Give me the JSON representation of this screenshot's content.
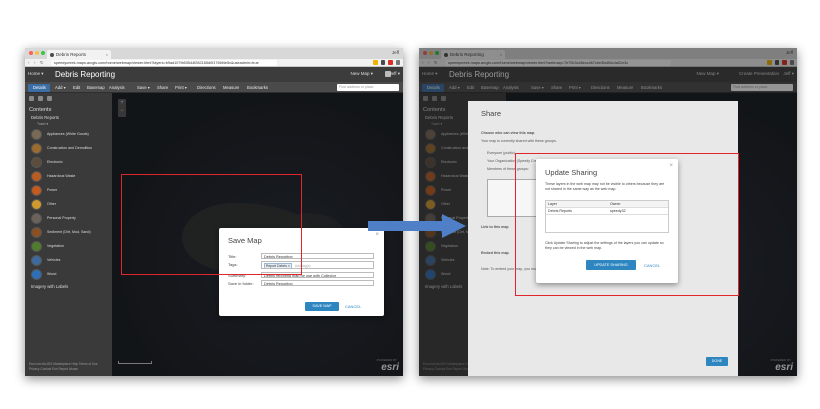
{
  "left_window": {
    "tab_title": "Debris Reports",
    "user_tag": "Jeff",
    "url": "speedycreek.maps.arcgis.com/home/webmap/viewer.html?layers=b9ad107fb53544f282165d0f1766f4e5c&useadmin=true",
    "home": "Home ▾",
    "map_title": "Debris Reporting",
    "new_map": "New Map ▾",
    "create_presentation": "",
    "user_menu": "Jeff ▾",
    "toolbar": {
      "details": "Details",
      "add": "Add ▾",
      "edit": "Edit",
      "basemap": "Basemap",
      "analysis": "Analysis",
      "save": "Save ▾",
      "share": "Share",
      "print": "Print ▾",
      "directions": "Directions",
      "measure": "Measure",
      "bookmarks": "Bookmarks",
      "search_placeholder": "Find address or place"
    },
    "contents": {
      "heading": "Contents",
      "root_layer": "Debris Reports",
      "sub_label": "Trash ▾",
      "layers": [
        {
          "label": "Appliances (White Goods)",
          "color": "#7a6a55"
        },
        {
          "label": "Construction and Demolition",
          "color": "#9c6b2d"
        },
        {
          "label": "Electronic",
          "color": "#5b4c3b"
        },
        {
          "label": "Hazardous Waste",
          "color": "#b85c22"
        },
        {
          "label": "Power",
          "color": "#c45a1d"
        },
        {
          "label": "Other",
          "color": "#d09a2c"
        },
        {
          "label": "Personal Property",
          "color": "#6b6259"
        },
        {
          "label": "Sediment (Dirt, Mud, Sand)",
          "color": "#8a4f23"
        },
        {
          "label": "Vegetation",
          "color": "#4f7d2b"
        },
        {
          "label": "Vehicles",
          "color": "#3d6a9c"
        },
        {
          "label": "Wood",
          "color": "#2d6fb8"
        }
      ],
      "imagery_label": "Imagery with Labels"
    },
    "footer": "Esri.com  ArcGIS Marketplace  Help  Terms of Use  Privacy  Contact Esri  Report Abuse",
    "dialog": {
      "title": "Save Map",
      "labels": {
        "title": "Title:",
        "tags": "Tags:",
        "summary": "Summary:",
        "folder": "Save in folder:"
      },
      "values": {
        "title": "Debris Reporting",
        "tag": "Report Debris",
        "tags_placeholder": "Add tag(s)",
        "summary": "Debris reporting map for use with Collector",
        "folder": "Debris Reporting"
      },
      "save_button": "SAVE MAP",
      "cancel_button": "CANCEL"
    }
  },
  "right_window": {
    "tab_title": "Debris Reporting",
    "user_tag": "Jeff",
    "url": "speedycreek.maps.arcgis.com/home/webmap/viewer.html?webmap=7b70b3c48ecc467cbe3bd84c4a31e3c",
    "home": "Home ▾",
    "map_title": "Debris Reporting",
    "new_map": "New Map ▾",
    "create_presentation": "Create Presentation",
    "user_menu": "Jeff ▾",
    "share": {
      "heading": "Share",
      "line1": "Choose who can view this map.",
      "line2": "Your map is currently shared with these groups.",
      "line3": "Everyone (public)",
      "line4": "Your Organization (Speedy Creek)",
      "line5": "Members of these groups:",
      "line6": "Link to this map",
      "line7": "Embed this map",
      "line8": "Note: To embed your map, you must share it publicly.",
      "done_button": "DONE"
    },
    "dialog": {
      "title": "Update Sharing",
      "description": "These layers in the web map may not be visible to others because they are not shared in the same way as the web map.",
      "columns": [
        "Layer",
        "Owner"
      ],
      "rows": [
        [
          "Debris Reports",
          "speedy32"
        ]
      ],
      "note": "Click Update Sharing to adjust the settings of the layers you can update so they can be viewed in the web map.",
      "update_button": "UPDATE SHARING",
      "cancel_button": "CANCEL"
    }
  },
  "colors": {
    "highlight": "#e0262b",
    "arrow": "#4f7fc7",
    "primary_button": "#2e86c1"
  }
}
